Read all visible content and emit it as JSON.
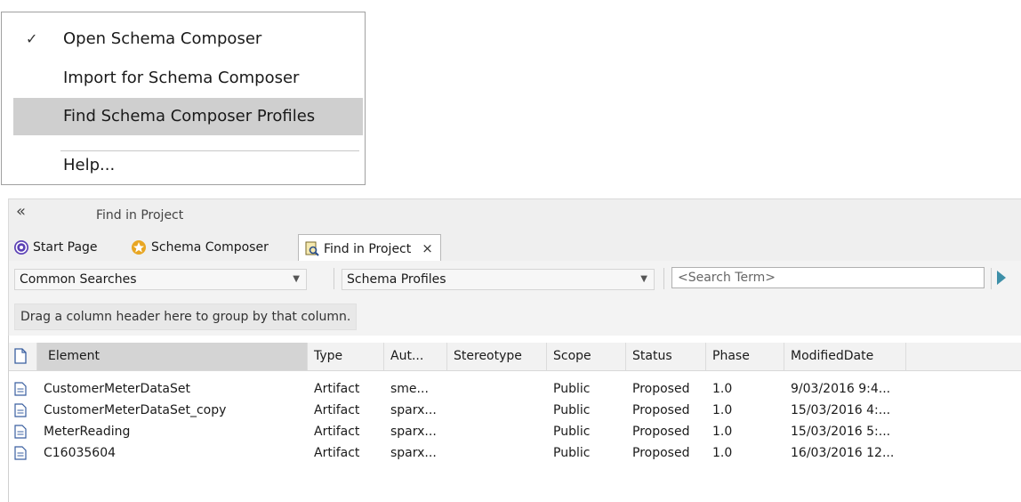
{
  "menu": {
    "items": [
      {
        "label": "Open Schema Composer",
        "checked": true
      },
      {
        "label": "Import for Schema Composer",
        "checked": false
      },
      {
        "label": "Find Schema Composer Profiles",
        "checked": false,
        "highlighted": true
      },
      {
        "label": "Help...",
        "checked": false
      }
    ],
    "check_glyph": "✓"
  },
  "panel": {
    "collapse_glyph": "«",
    "title": "Find in Project",
    "tabs": [
      {
        "label": "Start Page",
        "icon": "start-page-icon"
      },
      {
        "label": "Schema Composer",
        "icon": "schema-composer-icon"
      },
      {
        "label": "Find in Project",
        "icon": "find-in-project-icon",
        "active": true,
        "close": "×"
      }
    ],
    "toolbar": {
      "search_category": "Common Searches",
      "search_name": "Schema Profiles",
      "search_term_placeholder": "<Search Term>"
    },
    "group_hint": "Drag a column header here to group by that column.",
    "columns": [
      "Element",
      "Type",
      "Aut...",
      "Stereotype",
      "Scope",
      "Status",
      "Phase",
      "ModifiedDate"
    ],
    "rows": [
      [
        "CustomerMeterDataSet",
        "Artifact",
        "sme...",
        "",
        "Public",
        "Proposed",
        "1.0",
        "9/03/2016 9:4..."
      ],
      [
        "CustomerMeterDataSet_copy",
        "Artifact",
        "sparx...",
        "",
        "Public",
        "Proposed",
        "1.0",
        "15/03/2016 4:..."
      ],
      [
        "MeterReading",
        "Artifact",
        "sparx...",
        "",
        "Public",
        "Proposed",
        "1.0",
        "15/03/2016 5:..."
      ],
      [
        "C16035604",
        "Artifact",
        "sparx...",
        "",
        "Public",
        "Proposed",
        "1.0",
        "16/03/2016 12..."
      ]
    ]
  },
  "colors": {
    "menu_highlight": "#cfcfcf",
    "run_arrow": "#3d8fa8",
    "start_page_icon": "#5a3fb5",
    "schema_composer_icon": "#e8a623"
  }
}
